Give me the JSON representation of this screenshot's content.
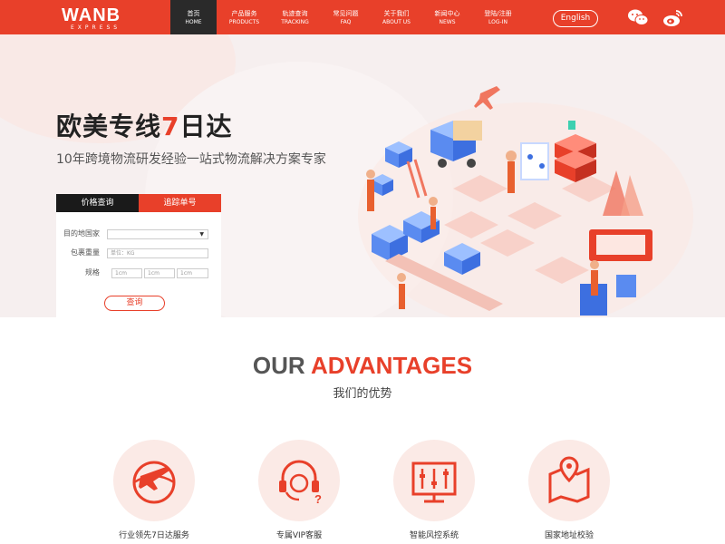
{
  "logo": {
    "main": "WANB",
    "sub": "EXPRESS"
  },
  "nav": [
    {
      "zh": "首页",
      "en": "HOME"
    },
    {
      "zh": "产品服务",
      "en": "PRODUCTS"
    },
    {
      "zh": "轨迹查询",
      "en": "TRACKING"
    },
    {
      "zh": "常见问题",
      "en": "FAQ"
    },
    {
      "zh": "关于我们",
      "en": "ABOUT US"
    },
    {
      "zh": "新闻中心",
      "en": "NEWS"
    },
    {
      "zh": "登陆/注册",
      "en": "LOG-IN"
    }
  ],
  "language_button": "English",
  "social": {
    "wechat_icon": "wechat-icon",
    "weibo_icon": "weibo-icon"
  },
  "hero": {
    "title_part1": "欧美专线",
    "title_accent": "7",
    "title_part2": "日达",
    "subtitle": "10年跨境物流研发经验一站式物流解决方案专家"
  },
  "quote_panel": {
    "tab_price": "价格查询",
    "tab_track": "追踪单号",
    "country_label": "目的地国家",
    "weight_label": "包裹重量",
    "weight_placeholder": "单位：KG",
    "size_label": "规格",
    "size_placeholder_1": "1cm",
    "size_placeholder_2": "1cm",
    "size_placeholder_3": "1cm",
    "submit": "查询"
  },
  "advantages": {
    "title_part1": "OUR",
    "title_part2": "ADVANTAGES",
    "subtitle": "我们的优势",
    "items": [
      {
        "label": "行业领先7日达服务",
        "icon": "plane-globe-icon"
      },
      {
        "label": "专属VIP客服",
        "icon": "headset-icon"
      },
      {
        "label": "智能风控系统",
        "icon": "control-panel-icon"
      },
      {
        "label": "国家地址校验",
        "icon": "map-pin-icon"
      }
    ]
  },
  "colors": {
    "accent": "#e8402a",
    "dark": "#1a1a1a"
  }
}
